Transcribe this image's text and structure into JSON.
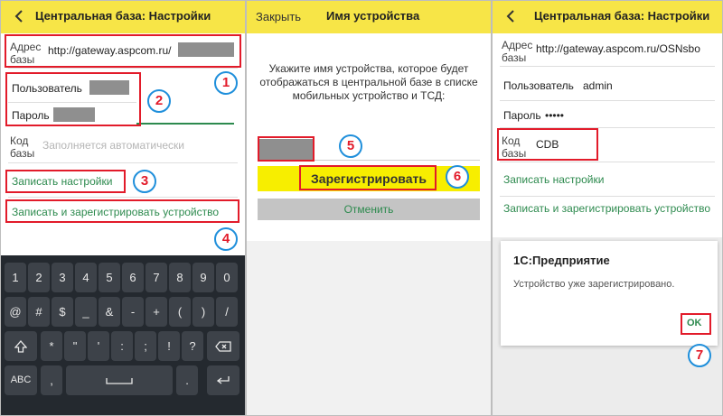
{
  "colors": {
    "header": "#f7e547",
    "annotation_box": "#e21b2a",
    "annotation_circle": "#1f8fdb",
    "link": "#2d8a4e",
    "register_bar": "#f7ee00"
  },
  "panel1": {
    "title": "Центральная база: Настройки",
    "address_label": "Адрес базы",
    "address_value": "http://gateway.aspcom.ru/",
    "user_label": "Пользователь",
    "password_label": "Пароль",
    "code_label": "Код базы",
    "code_placeholder": "Заполняется автоматически",
    "save_settings": "Записать настройки",
    "save_and_register": "Записать и зарегистрировать устройство",
    "keyboard": {
      "row1": [
        "1",
        "2",
        "3",
        "4",
        "5",
        "6",
        "7",
        "8",
        "9",
        "0"
      ],
      "row2": [
        "@",
        "#",
        "$",
        "_",
        "&",
        "-",
        "+",
        "(",
        ")",
        "/"
      ],
      "row3": [
        "*",
        "\"",
        "'",
        ":",
        ";",
        "!",
        "?"
      ],
      "row4_left": "ABC",
      "row4_mid": ",",
      "row4_right": "."
    }
  },
  "panel2": {
    "close_label": "Закрыть",
    "title": "Имя устройства",
    "message": "Укажите имя устройства, которое будет отображаться в центральной базе в списке мобильных устройство и ТСД:",
    "register_button": "Зарегистрировать",
    "cancel_button": "Отменить"
  },
  "panel3": {
    "title": "Центральная база: Настройки",
    "address_label": "Адрес базы",
    "address_value": "http://gateway.aspcom.ru/OSNsbo",
    "user_label": "Пользователь",
    "user_value": "admin",
    "password_label": "Пароль",
    "password_value": "•••••",
    "code_label": "Код базы",
    "code_value": "CDB",
    "save_settings": "Записать настройки",
    "save_and_register": "Записать и зарегистрировать устройство",
    "dialog_title": "1С:Предприятие",
    "dialog_message": "Устройство уже зарегистрировано.",
    "ok_button": "OK"
  },
  "badges": [
    "1",
    "2",
    "3",
    "4",
    "5",
    "6",
    "7"
  ]
}
